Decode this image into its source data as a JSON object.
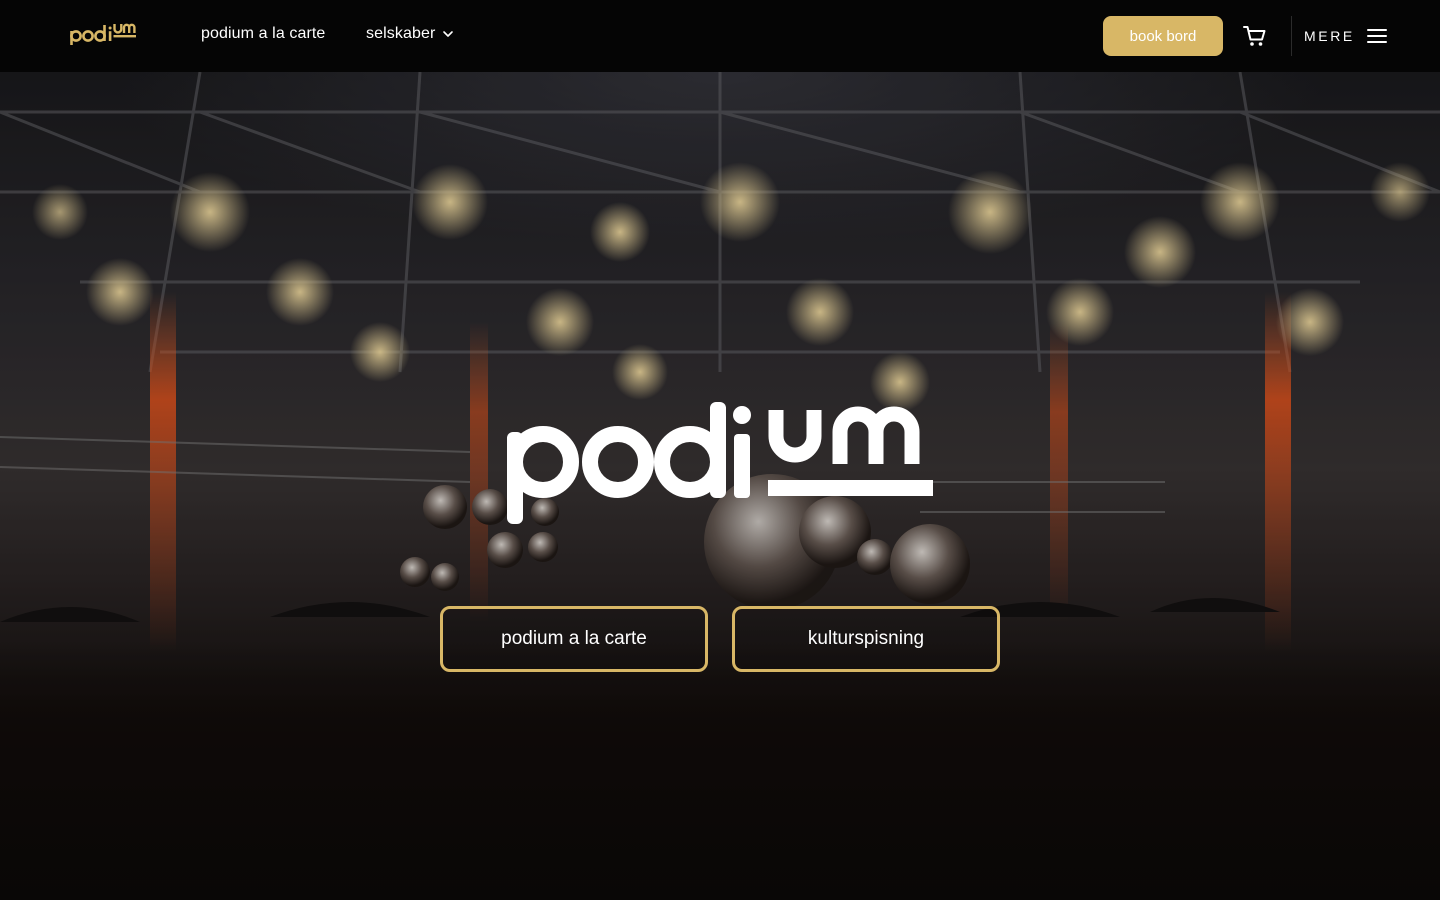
{
  "brand": {
    "name": "podium",
    "accent_color": "#d8b766"
  },
  "nav": {
    "items": [
      {
        "label": "podium a la carte"
      },
      {
        "label": "selskaber",
        "icon": "chevron-down-icon"
      }
    ],
    "book_button": "book bord",
    "cart_icon": "cart-icon",
    "menu_label": "MERE",
    "menu_icon": "hamburger-icon"
  },
  "hero": {
    "background": "event hall photo",
    "buttons": [
      {
        "label": "podium a la carte"
      },
      {
        "label": "kulturspisning"
      }
    ]
  }
}
